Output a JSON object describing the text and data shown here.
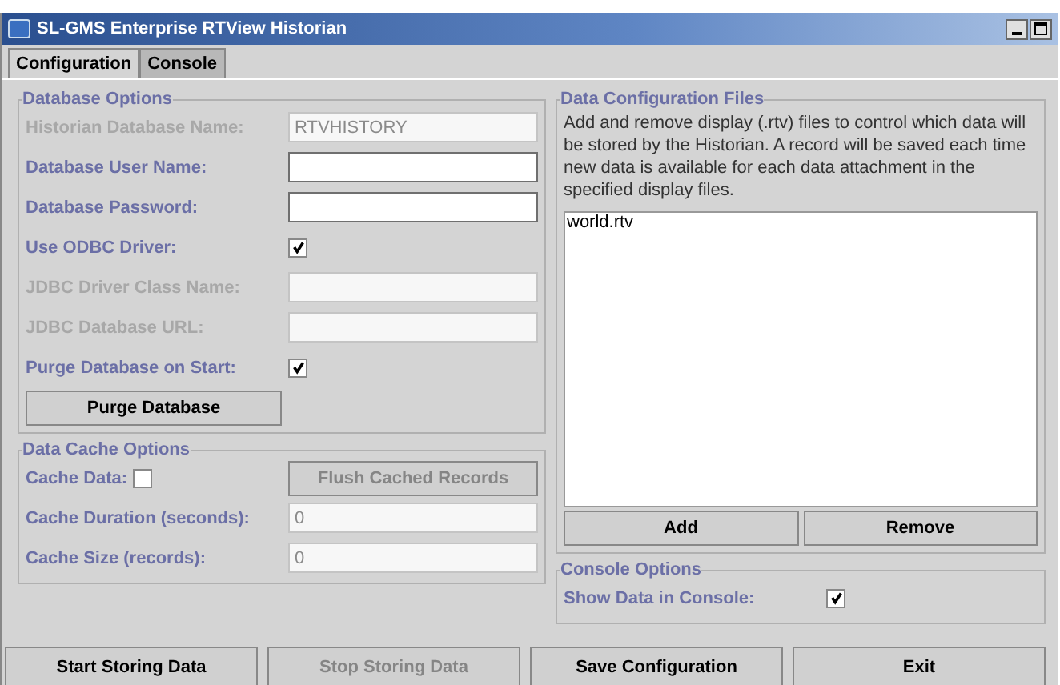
{
  "window": {
    "title": "SL-GMS Enterprise RTView Historian"
  },
  "tabs": [
    {
      "label": "Configuration",
      "selected": true
    },
    {
      "label": "Console",
      "selected": false
    }
  ],
  "database_options": {
    "title": "Database Options",
    "rows": [
      {
        "kind": "text",
        "label": "Historian Database Name:",
        "value": "RTVHISTORY",
        "disabled": true
      },
      {
        "kind": "text",
        "label": "Database User Name:",
        "value": "",
        "disabled": false
      },
      {
        "kind": "text",
        "label": "Database Password:",
        "value": "",
        "disabled": false
      },
      {
        "kind": "checkbox",
        "label": "Use ODBC Driver:",
        "checked": true,
        "disabled": false
      },
      {
        "kind": "text",
        "label": "JDBC Driver Class Name:",
        "value": "",
        "disabled": true
      },
      {
        "kind": "text",
        "label": "JDBC Database URL:",
        "value": "",
        "disabled": true
      },
      {
        "kind": "checkbox",
        "label": "Purge Database on Start:",
        "checked": true,
        "disabled": false
      },
      {
        "kind": "button",
        "label": "Purge Database",
        "disabled": false
      }
    ]
  },
  "data_cache_options": {
    "title": "Data Cache Options",
    "rows": [
      {
        "kind": "checkbox_button",
        "label": "Cache Data:",
        "checked": false,
        "disabled": false,
        "button": "Flush Cached Records",
        "button_disabled": true
      },
      {
        "kind": "labeled_field",
        "label": "Cache Duration (seconds):",
        "disabled": false,
        "field": {
          "value": "0",
          "disabled": true
        }
      },
      {
        "kind": "labeled_field",
        "label": "Cache Size (records):",
        "disabled": false,
        "field": {
          "value": "0",
          "disabled": true
        }
      }
    ]
  },
  "data_configuration_files": {
    "title": "Data Configuration Files",
    "description": "Add and remove display (.rtv) files to control which data will be stored by the Historian. A record will be saved each time new data is available for each data attachment in the specified display files.",
    "files": [
      "world.rtv"
    ],
    "buttons": [
      "Add",
      "Remove"
    ]
  },
  "console_options": {
    "title": "Console Options",
    "rows": [
      {
        "kind": "checkbox",
        "label": "Show Data in Console:",
        "checked": true,
        "disabled": false
      }
    ]
  },
  "footer_buttons": [
    {
      "label": "Start Storing Data",
      "disabled": false
    },
    {
      "label": "Stop Storing Data",
      "disabled": true
    },
    {
      "label": "Save Configuration",
      "disabled": false
    },
    {
      "label": "Exit",
      "disabled": false
    }
  ]
}
